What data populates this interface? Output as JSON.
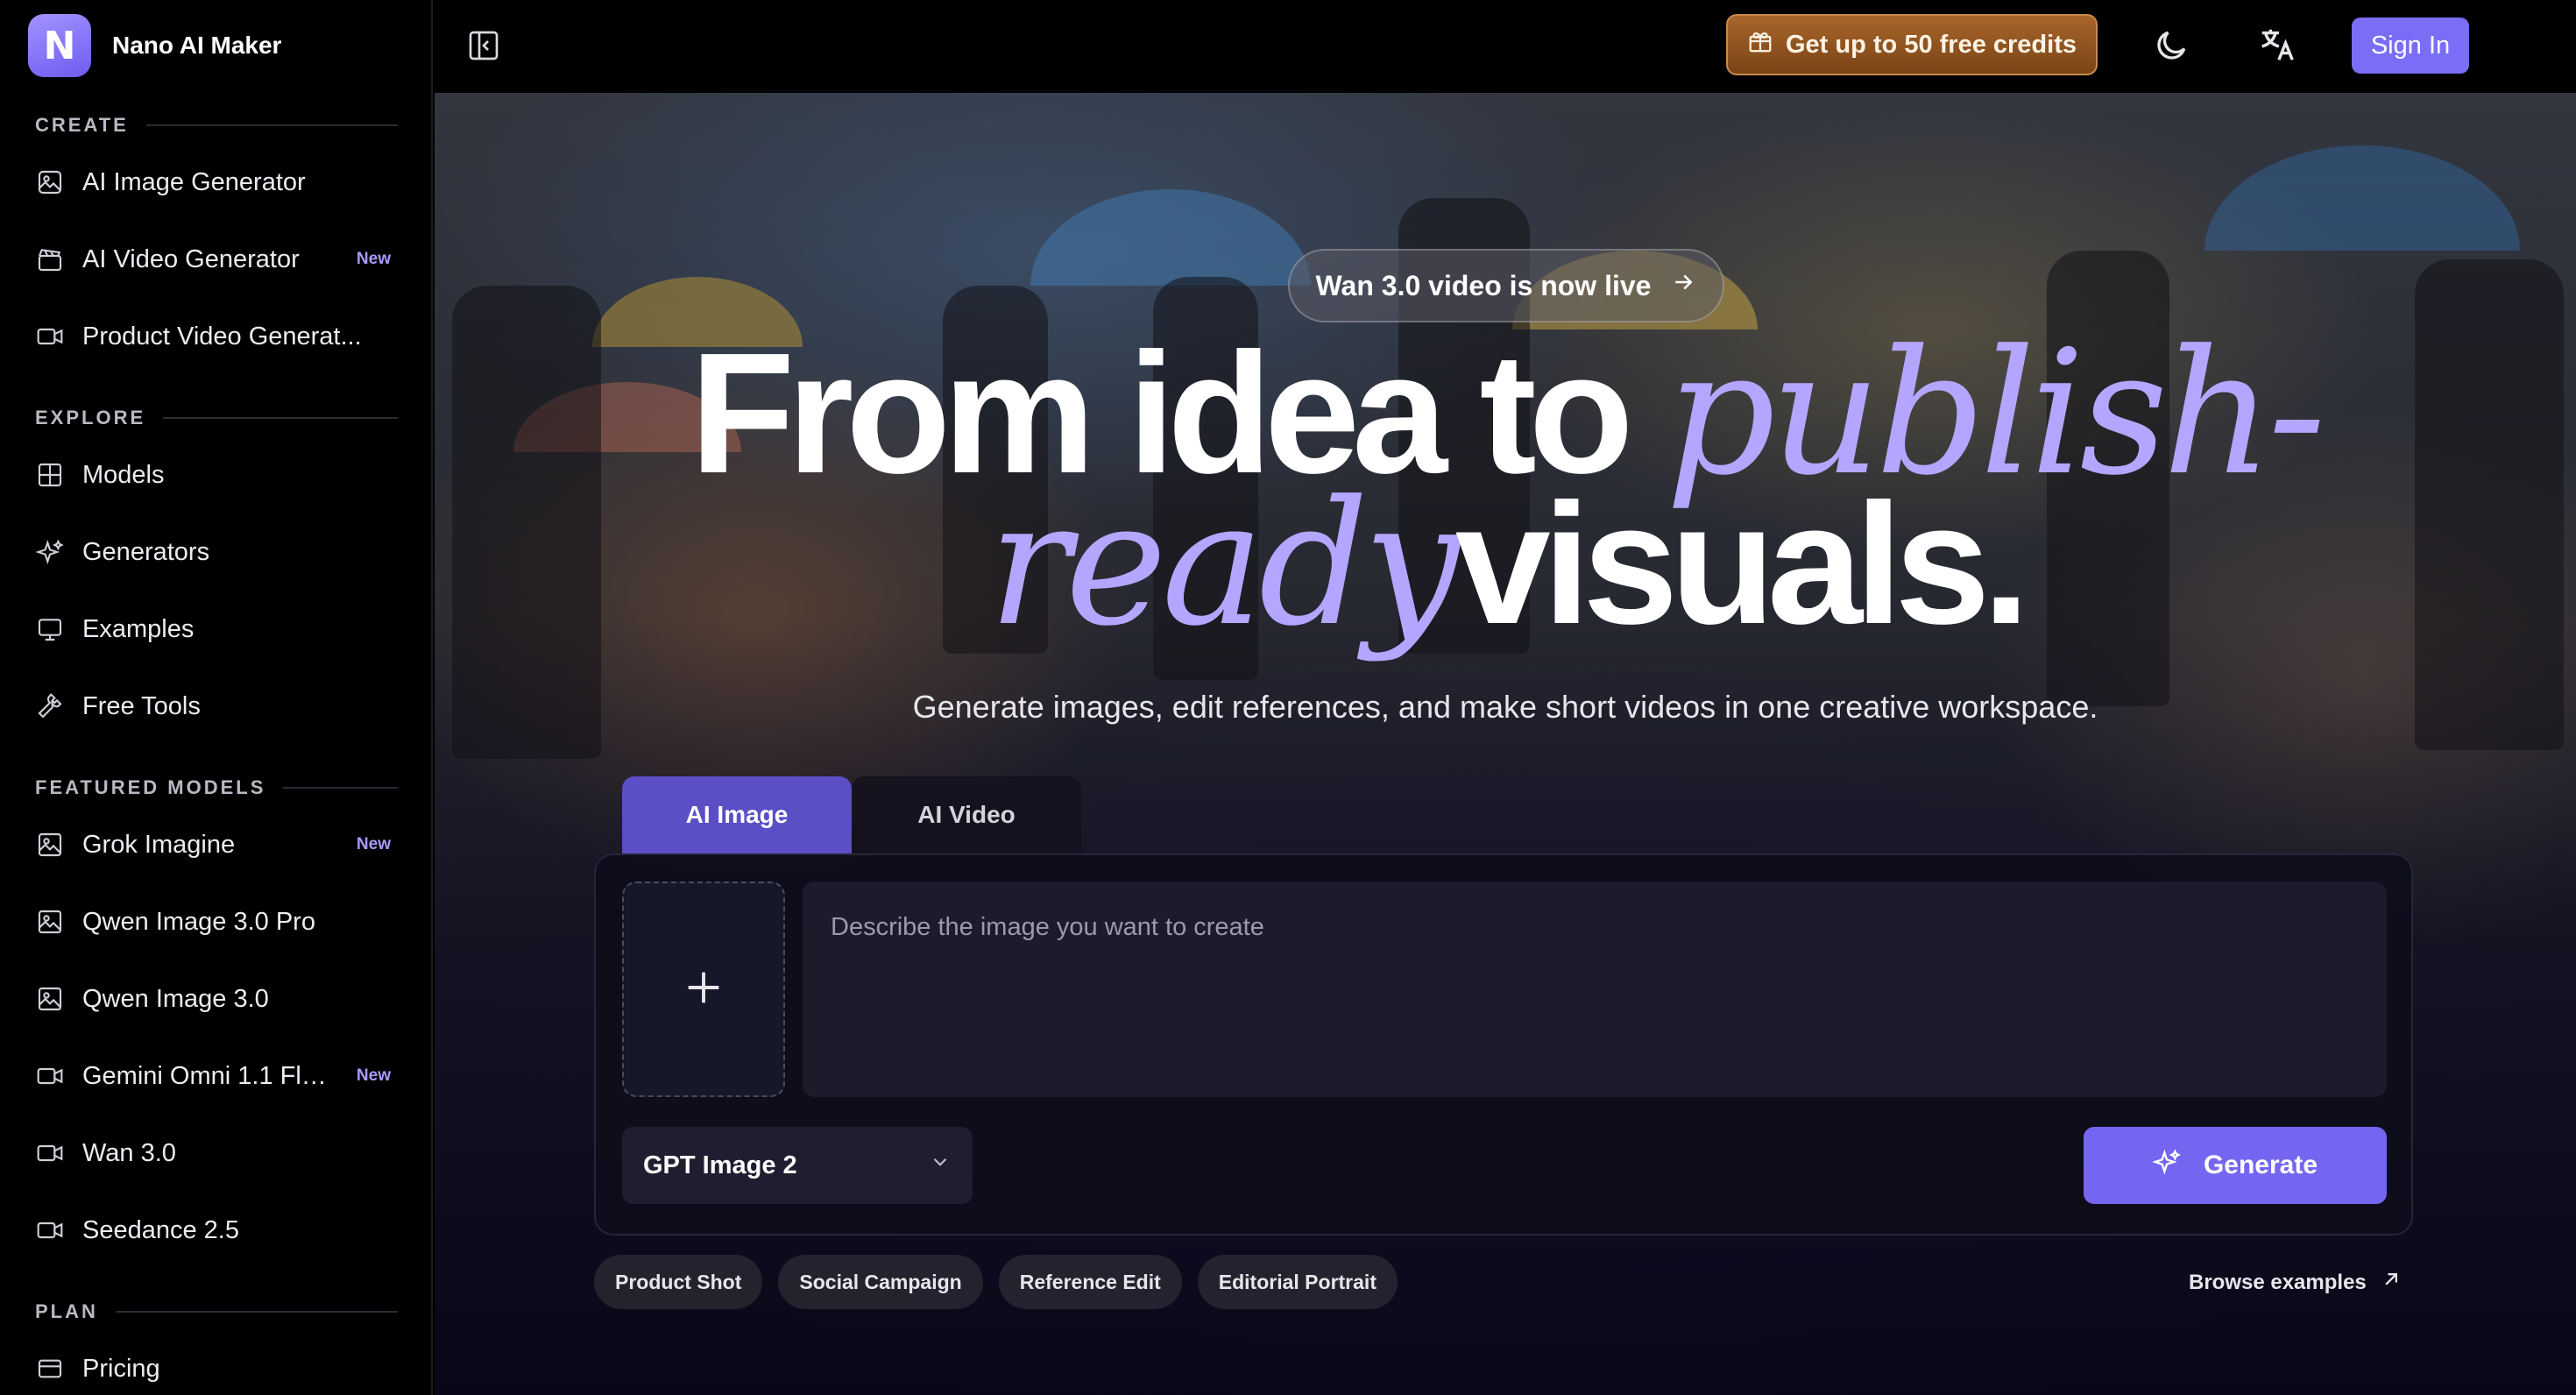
{
  "brand": {
    "name": "Nano AI Maker",
    "logo_letter": "N"
  },
  "sidebar": {
    "sections": [
      {
        "title": "CREATE"
      },
      {
        "title": "EXPLORE"
      },
      {
        "title": "FEATURED MODELS"
      },
      {
        "title": "PLAN"
      }
    ],
    "create": [
      {
        "label": "AI Image Generator",
        "icon": "image-edit-icon"
      },
      {
        "label": "AI Video Generator",
        "icon": "video-clapper-icon",
        "badge": "New"
      },
      {
        "label": "Product Video Generat...",
        "icon": "video-camera-icon"
      }
    ],
    "explore": [
      {
        "label": "Models",
        "icon": "grid-icon"
      },
      {
        "label": "Generators",
        "icon": "sparkles-icon"
      },
      {
        "label": "Examples",
        "icon": "monitor-icon"
      },
      {
        "label": "Free Tools",
        "icon": "wrench-icon"
      }
    ],
    "featured": [
      {
        "label": "Grok Imagine",
        "icon": "image-icon",
        "badge": "New"
      },
      {
        "label": "Qwen Image 3.0 Pro",
        "icon": "image-icon"
      },
      {
        "label": "Qwen Image 3.0",
        "icon": "image-icon"
      },
      {
        "label": "Gemini Omni 1.1 Fla...",
        "icon": "video-camera-icon",
        "badge": "New"
      },
      {
        "label": "Wan 3.0",
        "icon": "video-camera-icon"
      },
      {
        "label": "Seedance 2.5",
        "icon": "video-camera-icon"
      }
    ],
    "plan": [
      {
        "label": "Pricing",
        "icon": "credit-card-icon"
      }
    ]
  },
  "topbar": {
    "credits_label": "Get up to 50 free credits",
    "signin_label": "Sign In"
  },
  "hero": {
    "announcement": "Wan 3.0 video is now live",
    "headline_part1": "From idea to ",
    "headline_accent1": "publish-",
    "headline_accent2": "ready",
    "headline_part2": "visuals.",
    "subline": "Generate images, edit references, and make short videos in one creative workspace."
  },
  "composer": {
    "tabs": [
      {
        "label": "AI Image",
        "active": true
      },
      {
        "label": "AI Video",
        "active": false
      }
    ],
    "prompt_placeholder": "Describe the image you want to create",
    "prompt_value": "",
    "model_selected": "GPT Image 2",
    "generate_label": "Generate"
  },
  "chips": [
    "Product Shot",
    "Social Campaign",
    "Reference Edit",
    "Editorial Portrait"
  ],
  "browse_label": "Browse examples",
  "colors": {
    "accent": "#7466f0",
    "accent_text": "#b4a6ff",
    "credits": "#a8652a"
  }
}
